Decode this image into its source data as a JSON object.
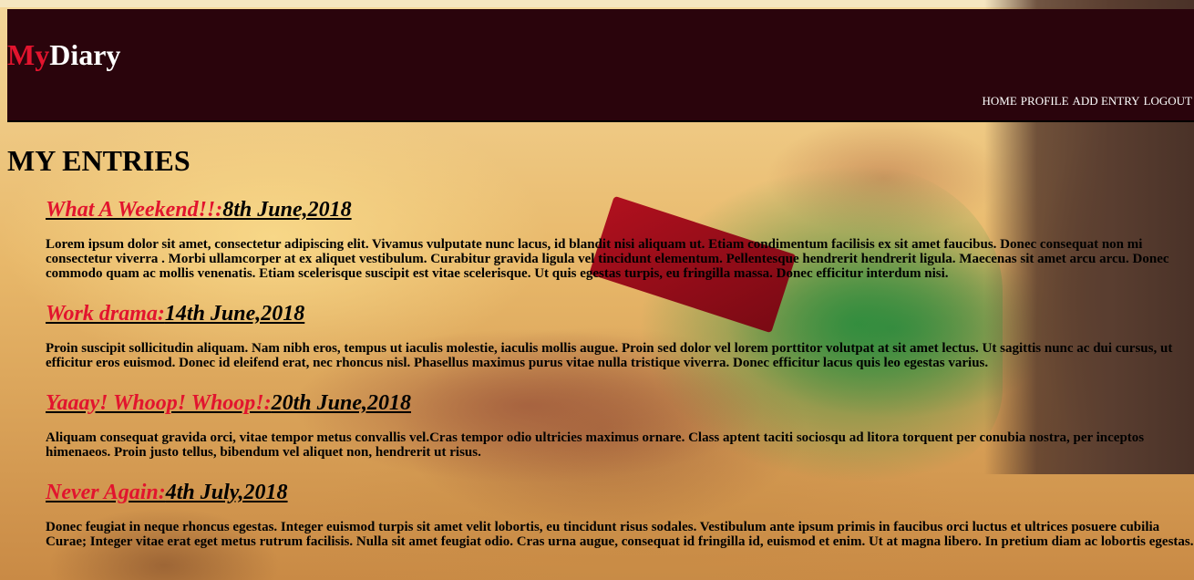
{
  "header": {
    "logo_my": "My",
    "logo_diary": "Diary",
    "nav": [
      "HOME",
      "PROFILE",
      "ADD ENTRY",
      "LOGOUT"
    ]
  },
  "page_title": "MY ENTRIES",
  "entries": [
    {
      "name": "What A Weekend!!:",
      "date": "8th June,2018",
      "body": "Lorem ipsum dolor sit amet, consectetur adipiscing elit. Vivamus vulputate nunc lacus, id blandit nisi aliquam ut. Etiam condimentum facilisis ex sit amet faucibus. Donec consequat non mi consectetur viverra . Morbi ullamcorper at ex aliquet vestibulum. Curabitur gravida ligula vel tincidunt elementum. Pellentesque hendrerit hendrerit ligula. Maecenas sit amet arcu arcu. Donec commodo quam ac mollis venenatis. Etiam scelerisque suscipit est vitae scelerisque. Ut quis egestas turpis, eu fringilla massa. Donec efficitur interdum nisi."
    },
    {
      "name": "Work drama:",
      "date": "14th June,2018",
      "body": "Proin suscipit sollicitudin aliquam. Nam nibh eros, tempus ut iaculis molestie, iaculis mollis augue. Proin sed dolor vel lorem porttitor volutpat at sit amet lectus. Ut sagittis nunc ac dui cursus, ut efficitur eros euismod. Donec id eleifend erat, nec rhoncus nisl. Phasellus maximus purus vitae nulla tristique viverra. Donec efficitur lacus quis leo egestas varius."
    },
    {
      "name": "Yaaay! Whoop! Whoop!:",
      "date": "20th June,2018",
      "body": "Aliquam consequat gravida orci, vitae tempor metus convallis vel.Cras tempor odio ultricies maximus ornare. Class aptent taciti sociosqu ad litora torquent per conubia nostra, per inceptos himenaeos. Proin justo tellus, bibendum vel aliquet non, hendrerit ut risus."
    },
    {
      "name": "Never Again:",
      "date": "4th July,2018",
      "body": "Donec feugiat in neque rhoncus egestas. Integer euismod turpis sit amet velit lobortis, eu tincidunt risus sodales. Vestibulum ante ipsum primis in faucibus orci luctus et ultrices posuere cubilia Curae; Integer vitae erat eget metus rutrum facilisis. Nulla sit amet feugiat odio. Cras urna augue, consequat id fringilla id, euismod et enim. Ut at magna libero. In pretium diam ac lobortis egestas."
    }
  ]
}
